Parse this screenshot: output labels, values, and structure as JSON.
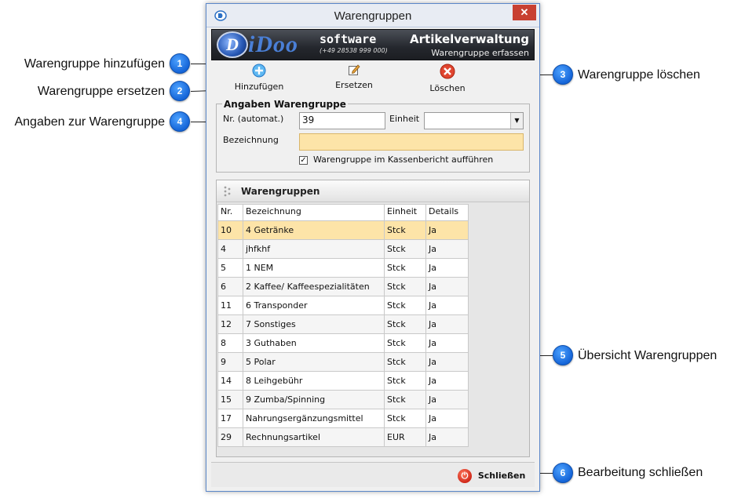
{
  "window": {
    "title": "Warengruppen",
    "close_glyph": "✕"
  },
  "banner": {
    "logo_mark": "D",
    "logo_text": "iDoo",
    "software": "software",
    "phone": "(+49 28538 999 000)",
    "app_title": "Artikelverwaltung",
    "app_subtitle": "Warengruppe erfassen"
  },
  "toolbar": {
    "add_label": "Hinzufügen",
    "replace_label": "Ersetzen",
    "delete_label": "Löschen"
  },
  "form": {
    "legend": "Angaben Warengruppe",
    "nr_label": "Nr. (automat.)",
    "nr_value": "39",
    "unit_label": "Einheit",
    "unit_value": "",
    "desc_label": "Bezeichnung",
    "desc_value": "",
    "checkbox_label": "Warengruppe im Kassenbericht aufführen",
    "checkbox_checked": true,
    "check_glyph": "✓"
  },
  "list": {
    "title": "Warengruppen",
    "columns": [
      "Nr.",
      "Bezeichnung",
      "Einheit",
      "Details"
    ],
    "rows": [
      [
        "10",
        "4 Getränke",
        "Stck",
        "Ja"
      ],
      [
        "4",
        "jhfkhf",
        "Stck",
        "Ja"
      ],
      [
        "5",
        "1 NEM",
        "Stck",
        "Ja"
      ],
      [
        "6",
        "2 Kaffee/ Kaffeespezialitäten",
        "Stck",
        "Ja"
      ],
      [
        "11",
        "6 Transponder",
        "Stck",
        "Ja"
      ],
      [
        "12",
        "7 Sonstiges",
        "Stck",
        "Ja"
      ],
      [
        "8",
        "3 Guthaben",
        "Stck",
        "Ja"
      ],
      [
        "9",
        "5 Polar",
        "Stck",
        "Ja"
      ],
      [
        "14",
        "8 Leihgebühr",
        "Stck",
        "Ja"
      ],
      [
        "15",
        "9 Zumba/Spinning",
        "Stck",
        "Ja"
      ],
      [
        "17",
        "Nahrungsergänzungsmittel",
        "Stck",
        "Ja"
      ],
      [
        "29",
        "Rechnungsartikel",
        "EUR",
        "Ja"
      ]
    ],
    "selected_row": 0
  },
  "footer": {
    "close_label": "Schließen",
    "power_glyph": "⏻"
  },
  "annotations": [
    {
      "n": "1",
      "text": "Warengruppe hinzufügen"
    },
    {
      "n": "2",
      "text": "Warengruppe ersetzen"
    },
    {
      "n": "3",
      "text": "Warengruppe löschen"
    },
    {
      "n": "4",
      "text": "Angaben zur Warengruppe"
    },
    {
      "n": "5",
      "text": "Übersicht Warengruppen"
    },
    {
      "n": "6",
      "text": "Bearbeitung schließen"
    }
  ],
  "colors": {
    "accent": "#1565d8",
    "selected_row": "#fde4a8",
    "desc_field": "#fde4a8",
    "close_red": "#c84031"
  },
  "icons": [
    "add-icon",
    "edit-icon",
    "delete-icon",
    "grip-icon",
    "power-icon",
    "app-icon"
  ]
}
